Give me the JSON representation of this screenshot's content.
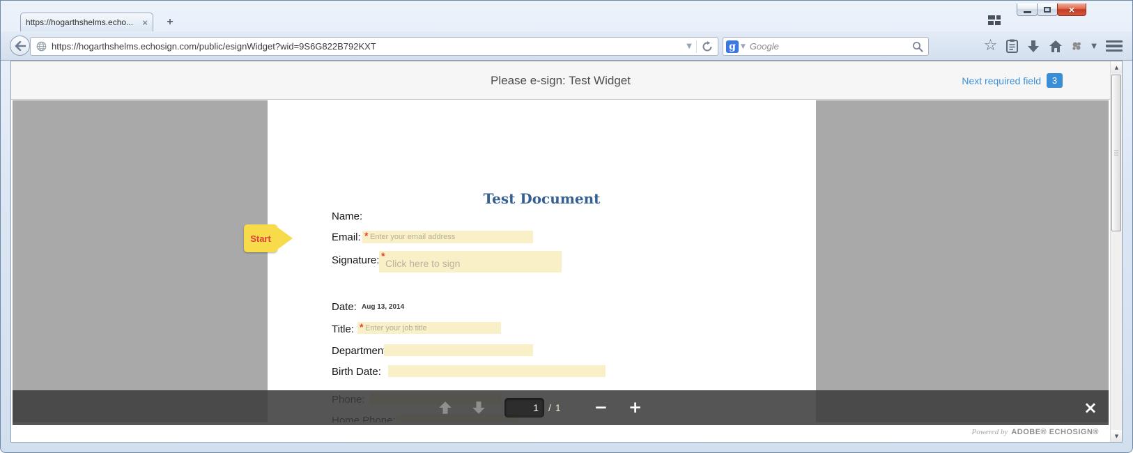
{
  "window": {
    "tab_title": "https://hogarthshelms.echo...",
    "tab_close": "×",
    "new_tab_label": "+",
    "url": "https://hogarthshelms.echosign.com/public/esignWidget?wid=9S6G822B792KXT",
    "search_placeholder": "Google",
    "close_glyph": "×"
  },
  "page": {
    "header": {
      "title": "Please e-sign: Test Widget",
      "next_required_label": "Next required field",
      "next_required_count": "3"
    },
    "start_tag": {
      "label": "Start"
    },
    "document": {
      "title": "Test Document",
      "required_marker": "*",
      "fields": [
        {
          "label": "Name:",
          "required": false
        },
        {
          "label": "Email:",
          "required": true,
          "placeholder": "Enter your email address"
        },
        {
          "label": "Signature:",
          "required": true,
          "placeholder": "Click here to sign"
        },
        {
          "label": "Date:",
          "required": false,
          "value": "Aug 13, 2014"
        },
        {
          "label": "Title:",
          "required": true,
          "placeholder": "Enter your job title"
        },
        {
          "label": "Department:",
          "required": false
        },
        {
          "label": "Birth Date:",
          "required": false
        },
        {
          "label": "Phone:",
          "required": false
        },
        {
          "label": "Home Phone:",
          "required": false
        }
      ]
    },
    "toolbar": {
      "page_current": "1",
      "page_separator": "/",
      "page_total": "1",
      "close_glyph": "×"
    },
    "footer": {
      "powered_by": "Powered by",
      "brand": "ADOBE® ECHOSIGN®"
    }
  },
  "colors": {
    "accent_blue": "#3d8fd6",
    "field_yellow": "#faf0c8",
    "required_red": "#e8402a",
    "doc_title_blue": "#365f91",
    "start_tag_yellow": "#f7db4b",
    "start_tag_text": "#e23d3d",
    "doc_area_gray": "#a9a9a9",
    "toolbar_dark": "#3c3c3c"
  }
}
